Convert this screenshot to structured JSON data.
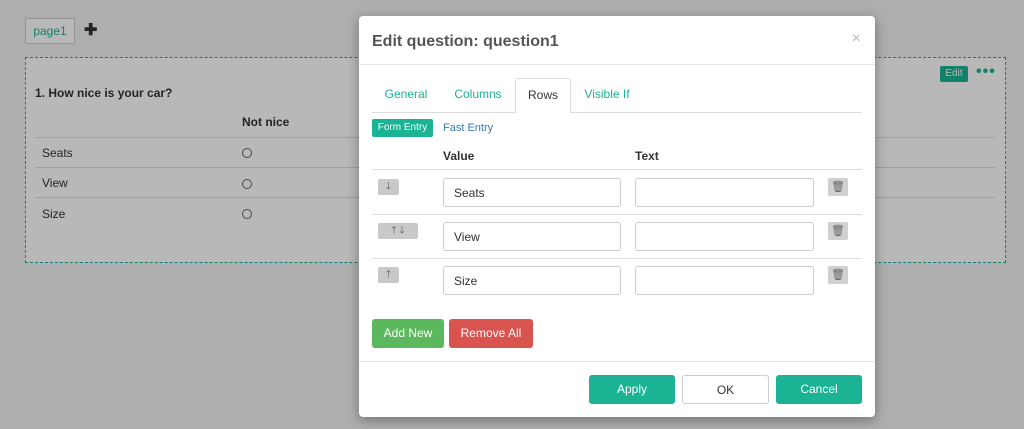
{
  "editor": {
    "page_tab": "page1",
    "question_title": "1. How nice is your car?",
    "column_header": "Not nice",
    "rows": [
      "Seats",
      "View",
      "Size"
    ],
    "edit_label": "Edit"
  },
  "modal": {
    "title": "Edit question: question1",
    "close_glyph": "×",
    "tabs": [
      "General",
      "Columns",
      "Rows",
      "Visible If"
    ],
    "active_tab": "Rows",
    "entry_modes": {
      "form": "Form Entry",
      "fast": "Fast Entry"
    },
    "table_headers": {
      "value": "Value",
      "text": "Text"
    },
    "rows": [
      {
        "value": "Seats",
        "text": ""
      },
      {
        "value": "View",
        "text": ""
      },
      {
        "value": "Size",
        "text": ""
      }
    ],
    "buttons": {
      "add_new": "Add New",
      "remove_all": "Remove All",
      "apply": "Apply",
      "ok": "OK",
      "cancel": "Cancel"
    }
  },
  "colors": {
    "accent": "#1ab394",
    "add": "#5cb85c",
    "remove": "#d9534f"
  }
}
